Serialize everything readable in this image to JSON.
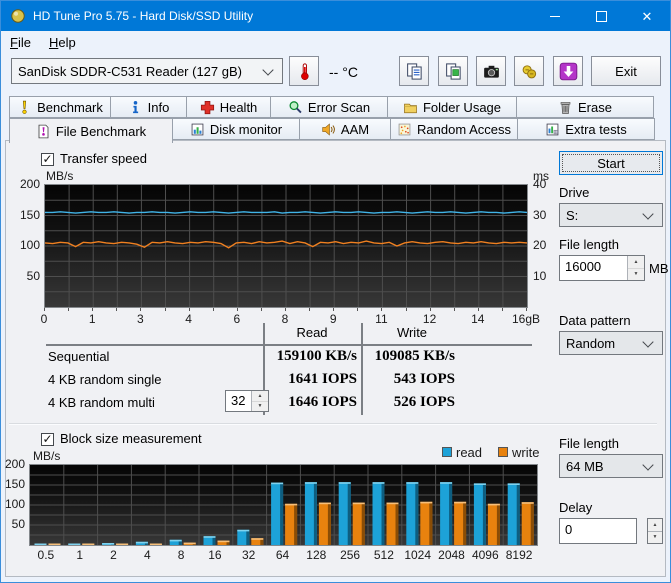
{
  "window": {
    "title": "HD Tune Pro 5.75 - Hard Disk/SSD Utility"
  },
  "menu": {
    "items": [
      {
        "label": "File"
      },
      {
        "label": "Help"
      }
    ]
  },
  "toolbar": {
    "device_selector": {
      "value": "SanDisk SDDR-C531 Reader (127 gB)"
    },
    "temperature_button_icon": "thermometer-icon",
    "temperature": "-- °C",
    "buttons": [
      {
        "icon": "copy-text-icon"
      },
      {
        "icon": "copy-image-icon"
      },
      {
        "icon": "screenshot-icon"
      },
      {
        "icon": "options-icon"
      },
      {
        "icon": "update-icon"
      }
    ],
    "exit_label": "Exit"
  },
  "tabs": {
    "row1": [
      {
        "label": "Benchmark",
        "icon": "benchmark-icon"
      },
      {
        "label": "Info",
        "icon": "info-icon"
      },
      {
        "label": "Health",
        "icon": "health-icon"
      },
      {
        "label": "Error Scan",
        "icon": "error-scan-icon"
      },
      {
        "label": "Folder Usage",
        "icon": "folder-icon"
      },
      {
        "label": "Erase",
        "icon": "trash-icon"
      }
    ],
    "row2": [
      {
        "label": "File Benchmark",
        "icon": "file-benchmark-icon",
        "active": true
      },
      {
        "label": "Disk monitor",
        "icon": "disk-monitor-icon"
      },
      {
        "label": "AAM",
        "icon": "speaker-icon"
      },
      {
        "label": "Random Access",
        "icon": "random-access-icon"
      },
      {
        "label": "Extra tests",
        "icon": "extra-tests-icon"
      }
    ]
  },
  "panel": {
    "transfer_speed_label": "Transfer speed",
    "block_size_label": "Block size measurement",
    "results": {
      "headers": {
        "read": "Read",
        "write": "Write"
      },
      "rows": [
        {
          "label": "Sequential",
          "read": "159100 KB/s",
          "write": "109085 KB/s"
        },
        {
          "label": "4 KB random single",
          "read": "1641 IOPS",
          "write": "543 IOPS"
        },
        {
          "label": "4 KB random multi",
          "spinner": "32",
          "read": "1646 IOPS",
          "write": "526 IOPS"
        }
      ]
    }
  },
  "sidebar": {
    "start_label": "Start",
    "drive": {
      "label": "Drive",
      "value": "S:"
    },
    "file_length": {
      "label": "File length",
      "value": "16000",
      "unit": "MB"
    },
    "data_pattern": {
      "label": "Data pattern",
      "value": "Random"
    },
    "file_length_block": {
      "label": "File length",
      "value": "64 MB"
    },
    "delay": {
      "label": "Delay",
      "value": "0"
    }
  },
  "chart_data": [
    {
      "type": "line",
      "name": "transfer_speed",
      "ylabel_left": "MB/s",
      "ylabel_right": "ms",
      "ylim": [
        0,
        200
      ],
      "ylim_right": [
        0,
        40
      ],
      "ytick_values": [
        200,
        150,
        100,
        50
      ],
      "yticks_left": [
        "200",
        "150",
        "100",
        "50"
      ],
      "yticks_right": [
        "40",
        "30",
        "20",
        "10"
      ],
      "x_ticks": [
        "0",
        "1",
        "3",
        "4",
        "6",
        "8",
        "9",
        "11",
        "12",
        "14",
        "16gB"
      ],
      "x_divisions": 20,
      "grid_step": 25,
      "grid": true,
      "series": [
        {
          "name": "read",
          "color": "#41b4e8",
          "values": [
            155,
            155,
            156,
            155,
            154,
            155,
            156,
            155,
            155,
            156,
            155,
            154,
            155,
            155,
            156,
            155,
            155,
            154,
            155,
            156,
            155,
            155,
            156,
            155,
            154,
            155,
            156,
            155,
            155,
            155,
            156,
            154,
            155,
            155,
            156,
            155,
            154,
            155,
            156,
            155,
            155,
            156,
            155,
            154,
            155,
            155,
            156,
            155,
            154,
            155,
            156,
            155,
            155,
            156,
            155,
            154,
            155,
            156,
            155,
            155,
            154,
            155,
            156,
            155
          ]
        },
        {
          "name": "write",
          "color": "#f08020",
          "values": [
            105,
            104,
            106,
            105,
            99,
            106,
            105,
            107,
            105,
            104,
            106,
            105,
            103,
            98,
            106,
            105,
            107,
            105,
            104,
            106,
            105,
            107,
            106,
            104,
            97,
            105,
            106,
            104,
            107,
            105,
            106,
            108,
            104,
            107,
            105,
            99,
            106,
            105,
            107,
            104,
            106,
            105,
            108,
            105,
            104,
            106,
            100,
            105,
            107,
            105,
            104,
            106,
            107,
            105,
            104,
            106,
            105,
            107,
            105,
            104,
            106,
            105,
            106,
            105
          ]
        }
      ]
    },
    {
      "type": "bar",
      "name": "block_size",
      "ylabel": "MB/s",
      "ylim": [
        0,
        200
      ],
      "ytick_values": [
        200,
        150,
        100,
        50
      ],
      "yticks": [
        "200",
        "150",
        "100",
        "50"
      ],
      "categories": [
        "0.5",
        "1",
        "2",
        "4",
        "8",
        "16",
        "32",
        "64",
        "128",
        "256",
        "512",
        "1024",
        "2048",
        "4096",
        "8192"
      ],
      "grid_step": 25,
      "grid": true,
      "legend_position": "top-right",
      "series": [
        {
          "name": "read",
          "color": "#1da2d8",
          "color_dark": "#0e5e80",
          "color_light": "#7fd2ee",
          "values": [
            2,
            3,
            5,
            8,
            13,
            22,
            38,
            156,
            157,
            157,
            157,
            157,
            157,
            154,
            154
          ]
        },
        {
          "name": "write",
          "color": "#e8820e",
          "color_dark": "#8a4d06",
          "color_light": "#f6bf7a",
          "values": [
            1,
            1,
            2,
            3,
            6,
            11,
            17,
            103,
            106,
            106,
            106,
            108,
            108,
            103,
            107
          ]
        }
      ]
    }
  ]
}
